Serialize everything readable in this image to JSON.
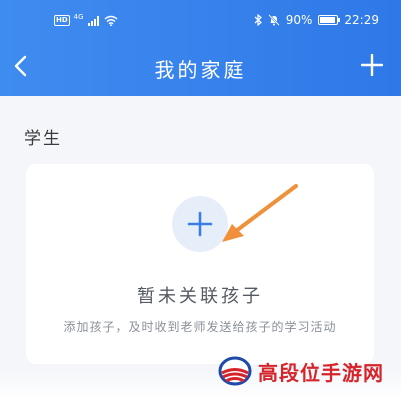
{
  "status_bar": {
    "hd_badge": "HD",
    "network": "4G",
    "battery_percent": "90%",
    "battery_level": 0.9,
    "time": "22:29",
    "icons": [
      "signal-icon",
      "wifi-icon",
      "bluetooth-icon",
      "mute-icon",
      "battery-icon"
    ]
  },
  "nav": {
    "title": "我的家庭",
    "back_icon": "chevron-left-icon",
    "add_icon": "plus-icon"
  },
  "section": {
    "title": "学生"
  },
  "empty_state": {
    "title": "暂未关联孩子",
    "description": "添加孩子，及时收到老师发送给孩子的学习活动",
    "add_icon": "plus-icon"
  },
  "watermark": {
    "text": "高段位手游网"
  },
  "colors": {
    "header_start": "#3f8cf0",
    "header_end": "#2f78e8",
    "page_background": "#f4f6fa",
    "card_background": "#ffffff",
    "add_circle": "#e6eefa",
    "accent_blue": "#3b7fe0",
    "arrow_orange": "#f0903a",
    "watermark_red": "#d5252b"
  }
}
